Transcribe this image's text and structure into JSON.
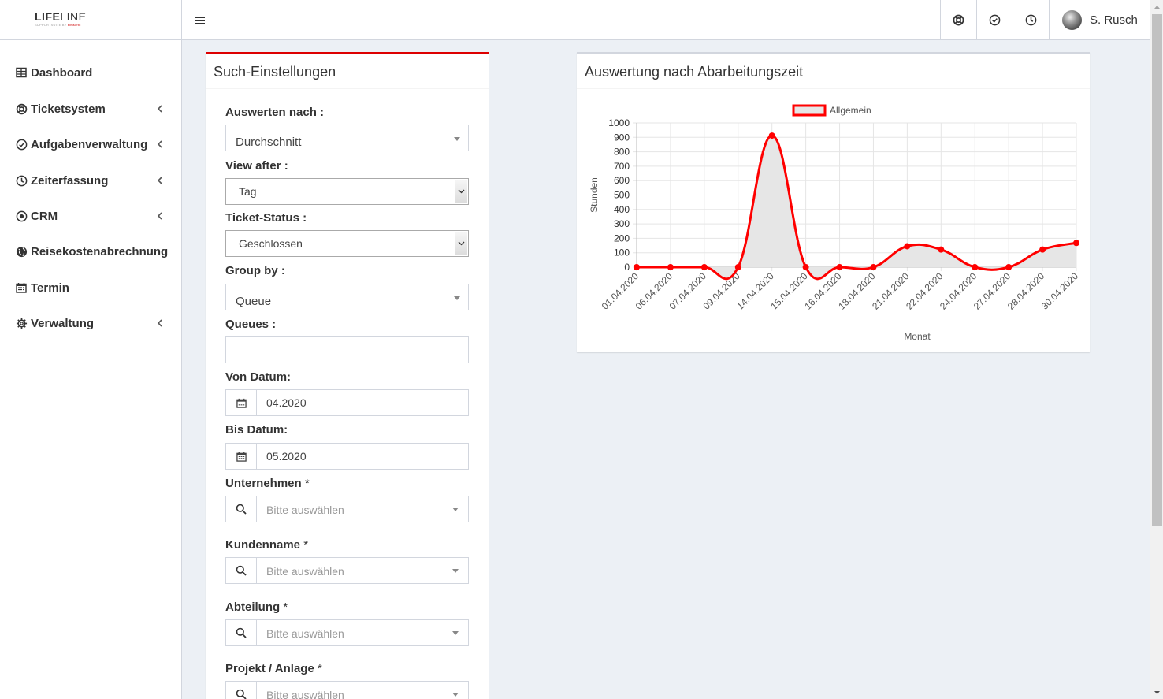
{
  "header": {
    "logo_main": "LIFE",
    "logo_main2": "LINE",
    "logo_sub": "SUPPORTSUITE BY ",
    "logo_sub_brand": "bimsoftit",
    "icons": [
      "life-ring-icon",
      "check-circle-icon",
      "clock-icon"
    ],
    "user_name": "S. Rusch"
  },
  "sidebar": {
    "items": [
      {
        "label": "Dashboard",
        "icon": "table-icon",
        "has_submenu": false
      },
      {
        "label": "Ticketsystem",
        "icon": "life-ring-icon",
        "has_submenu": true
      },
      {
        "label": "Aufgabenverwaltung",
        "icon": "check-circle-icon",
        "has_submenu": true
      },
      {
        "label": "Zeiterfassung",
        "icon": "clock-icon",
        "has_submenu": true
      },
      {
        "label": "CRM",
        "icon": "dot-circle-icon",
        "has_submenu": true
      },
      {
        "label": "Reisekostenabrechnung",
        "icon": "globe-icon",
        "has_submenu": false
      },
      {
        "label": "Termin",
        "icon": "calendar-icon",
        "has_submenu": false
      },
      {
        "label": "Verwaltung",
        "icon": "gear-icon",
        "has_submenu": true
      }
    ]
  },
  "search": {
    "title": "Such-Einstellungen",
    "auswerten_label": "Auswerten nach :",
    "auswerten_value": "Durchschnitt",
    "view_after_label": "View after :",
    "view_after_value": "Tag",
    "ticket_status_label": "Ticket-Status :",
    "ticket_status_value": "Geschlossen",
    "group_by_label": "Group by :",
    "group_by_value": "Queue",
    "queues_label": "Queues :",
    "queues_value": "",
    "von_label": "Von Datum:",
    "von_value": "04.2020",
    "bis_label": "Bis Datum:",
    "bis_value": "05.2020",
    "unternehmen_label": "Unternehmen",
    "kundenname_label": "Kundenname",
    "abteilung_label": "Abteilung",
    "projekt_label": "Projekt / Anlage",
    "required_mark": "*",
    "placeholder": "Bitte auswählen"
  },
  "chart_panel": {
    "title": "Auswertung nach Abarbeitungszeit"
  },
  "chart_data": {
    "type": "line",
    "categories": [
      "01.04.2020",
      "06.04.2020",
      "07.04.2020",
      "09.04.2020",
      "14.04.2020",
      "15.04.2020",
      "16.04.2020",
      "18.04.2020",
      "21.04.2020",
      "22.04.2020",
      "24.04.2020",
      "27.04.2020",
      "28.04.2020",
      "30.04.2020"
    ],
    "series": [
      {
        "name": "Allgemein",
        "values": [
          0,
          0,
          0,
          0,
          912,
          0,
          0,
          0,
          145,
          122,
          0,
          0,
          122,
          168
        ],
        "color": "#ff0000",
        "fill": "#e6e6e6"
      }
    ],
    "xlabel": "Monat",
    "ylabel": "Stunden",
    "ylim": [
      0,
      1000
    ],
    "yticks": [
      0,
      100,
      200,
      300,
      400,
      500,
      600,
      700,
      800,
      900,
      1000
    ],
    "legend": "top",
    "grid": true
  }
}
